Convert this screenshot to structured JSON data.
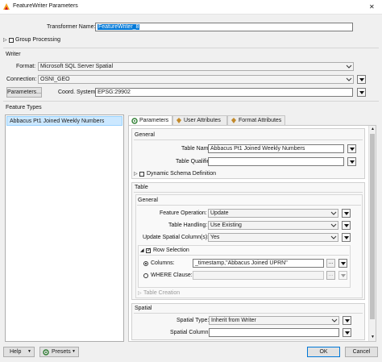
{
  "window": {
    "title": "FeatureWriter Parameters",
    "close_glyph": "✕"
  },
  "transformer": {
    "name_label": "Transformer Name:",
    "name_value": "FeatureWriter_8"
  },
  "group_processing": {
    "label": "Group Processing"
  },
  "writer": {
    "section_label": "Writer",
    "format_label": "Format:",
    "format_value": "Microsoft SQL Server Spatial",
    "connection_label": "Connection:",
    "connection_value": "OSNI_GEO",
    "parameters_button": "Parameters...",
    "coord_label": "Coord. System:",
    "coord_value": "EPSG:29902"
  },
  "feature_types": {
    "section_label": "Feature Types",
    "items": [
      "Abbacus Pt1 Joined Weekly Numbers"
    ]
  },
  "tabs": [
    {
      "label": "Parameters",
      "active": true
    },
    {
      "label": "User Attributes",
      "active": false
    },
    {
      "label": "Format Attributes",
      "active": false
    }
  ],
  "general": {
    "section_label": "General",
    "table_name_label": "Table Name:",
    "table_name_value": "Abbacus Pt1 Joined Weekly Numbers",
    "table_qualifier_label": "Table Qualifier:",
    "table_qualifier_value": "",
    "dynamic_schema_label": "Dynamic Schema Definition"
  },
  "table": {
    "section_label": "Table",
    "general_label": "General",
    "feature_operation_label": "Feature Operation:",
    "feature_operation_value": "Update",
    "table_handling_label": "Table Handling:",
    "table_handling_value": "Use Existing",
    "update_spatial_label": "Update Spatial Column(s):",
    "update_spatial_value": "Yes",
    "row_selection_label": "Row Selection",
    "columns_label": "Columns:",
    "columns_value": "_timestamp,\"Abbacus Joined UPRN\"",
    "where_label": "WHERE Clause:",
    "where_value": "",
    "ellipsis": "...",
    "table_creation_label": "Table Creation"
  },
  "spatial": {
    "section_label": "Spatial",
    "spatial_type_label": "Spatial Type:",
    "spatial_type_value": "Inherit from Writer",
    "spatial_column_label": "Spatial Column:",
    "spatial_column_value": ""
  },
  "footer": {
    "help_button": "Help",
    "presets_button": "Presets",
    "ok_button": "OK",
    "cancel_button": "Cancel"
  }
}
